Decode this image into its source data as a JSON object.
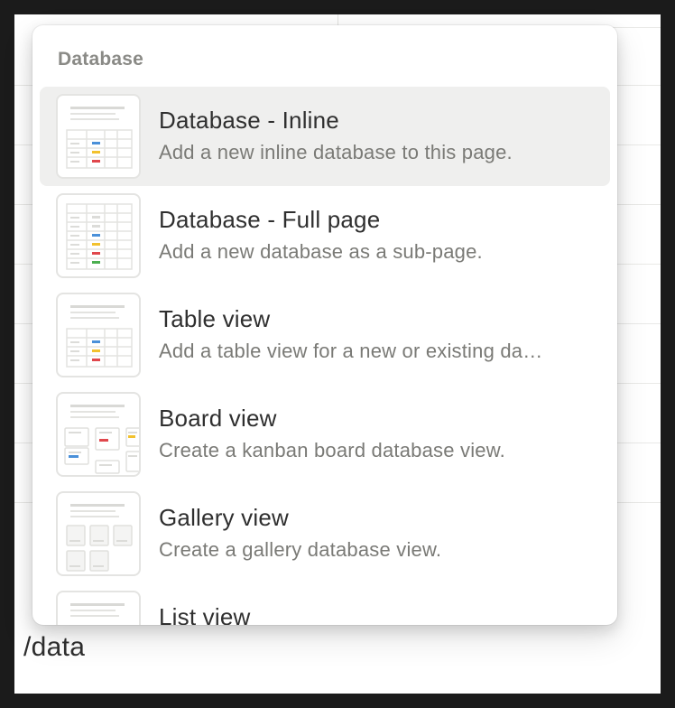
{
  "command_input": {
    "value": "/data"
  },
  "menu": {
    "section_title": "Database",
    "items": [
      {
        "title": "Database - Inline",
        "description": "Add a new inline database to this page.",
        "icon": "inline-database-icon",
        "active": true
      },
      {
        "title": "Database - Full page",
        "description": "Add a new database as a sub-page.",
        "icon": "full-page-database-icon",
        "active": false
      },
      {
        "title": "Table view",
        "description": "Add a table view for a new or existing da…",
        "icon": "table-view-icon",
        "active": false
      },
      {
        "title": "Board view",
        "description": "Create a kanban board database view.",
        "icon": "board-view-icon",
        "active": false
      },
      {
        "title": "Gallery view",
        "description": "Create a gallery database view.",
        "icon": "gallery-view-icon",
        "active": false
      },
      {
        "title": "List view",
        "description": "",
        "icon": "list-view-icon",
        "active": false
      }
    ]
  },
  "colors": {
    "blue": "#4a90d9",
    "yellow": "#f2c12e",
    "red": "#e0474c",
    "green": "#4caf50",
    "highlight": "#efefee"
  }
}
